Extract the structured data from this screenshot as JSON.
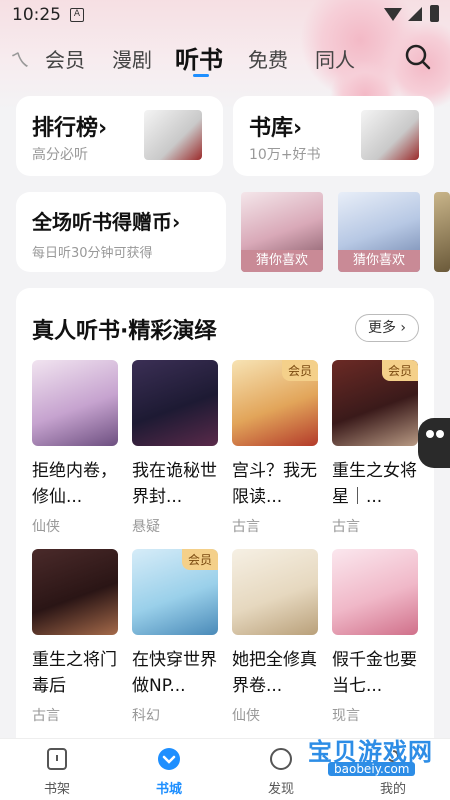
{
  "status": {
    "time": "10:25",
    "notification_icon": "A"
  },
  "tabs": [
    {
      "label": "会员"
    },
    {
      "label": "漫剧"
    },
    {
      "label": "听书"
    },
    {
      "label": "免费"
    },
    {
      "label": "同人"
    }
  ],
  "ranking": {
    "title": "排行榜",
    "chevron": "›",
    "subtitle": "高分必听"
  },
  "library": {
    "title": "书库",
    "chevron": "›",
    "subtitle": "10万+好书"
  },
  "listen_coins": {
    "title": "全场听书得赠币",
    "chevron": "›",
    "subtitle": "每日听30分钟可获得"
  },
  "guess": [
    {
      "label": "猜你喜欢"
    },
    {
      "label": "猜你喜欢"
    }
  ],
  "section": {
    "title": "真人听书·精彩演绎",
    "more": "更多"
  },
  "vip_label": "会员",
  "books": [
    {
      "title": "拒绝内卷，修仙...",
      "genre": "仙侠",
      "vip": false
    },
    {
      "title": "我在诡秘世界封...",
      "genre": "悬疑",
      "vip": false
    },
    {
      "title": "宫斗？我无限读...",
      "genre": "古言",
      "vip": true
    },
    {
      "title": "重生之女将星｜...",
      "genre": "古言",
      "vip": true
    },
    {
      "title": "重生之将门毒后",
      "genre": "古言",
      "vip": false
    },
    {
      "title": "在快穿世界做NP...",
      "genre": "科幻",
      "vip": true
    },
    {
      "title": "她把全修真界卷...",
      "genre": "仙侠",
      "vip": false
    },
    {
      "title": "假千金也要当七...",
      "genre": "现言",
      "vip": false
    }
  ],
  "bottom_nav": [
    {
      "label": "书架",
      "icon": "bookshelf-icon"
    },
    {
      "label": "书城",
      "icon": "bookstore-icon"
    },
    {
      "label": "发现",
      "icon": "discover-icon"
    },
    {
      "label": "我的",
      "icon": "profile-icon"
    }
  ],
  "watermark": {
    "text": "宝贝游戏网",
    "url": "baobeiy.com"
  }
}
